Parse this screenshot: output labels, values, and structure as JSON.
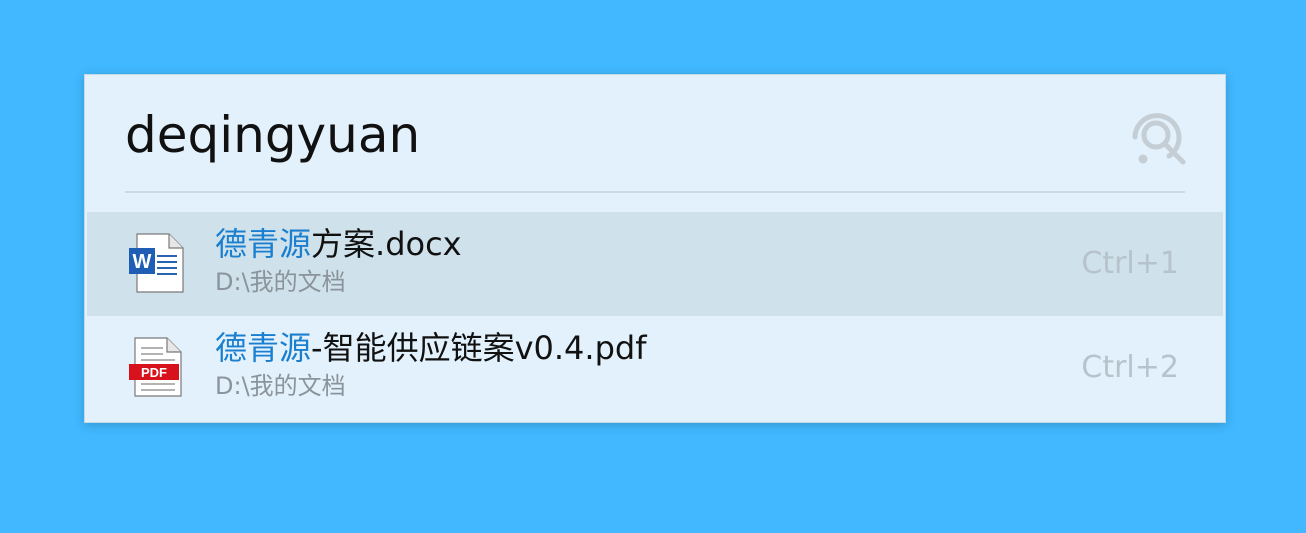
{
  "search": {
    "query": "deqingyuan"
  },
  "results": [
    {
      "icon": "word-doc-icon",
      "icon_badge": "W",
      "title_match": "德青源",
      "title_rest": "方案.docx",
      "path": "D:\\我的文档",
      "shortcut": "Ctrl+1",
      "selected": true
    },
    {
      "icon": "pdf-doc-icon",
      "icon_badge": "PDF",
      "title_match": "德青源",
      "title_rest": "-智能供应链案v0.4.pdf",
      "path": "D:\\我的文档",
      "shortcut": "Ctrl+2",
      "selected": false
    }
  ],
  "colors": {
    "background": "#41b8ff",
    "panel": "#e2f1fb",
    "selected_row": "#cfe1eb",
    "match_text": "#1b7fd0",
    "word_blue": "#1e5fb5",
    "pdf_red": "#d8121c"
  }
}
